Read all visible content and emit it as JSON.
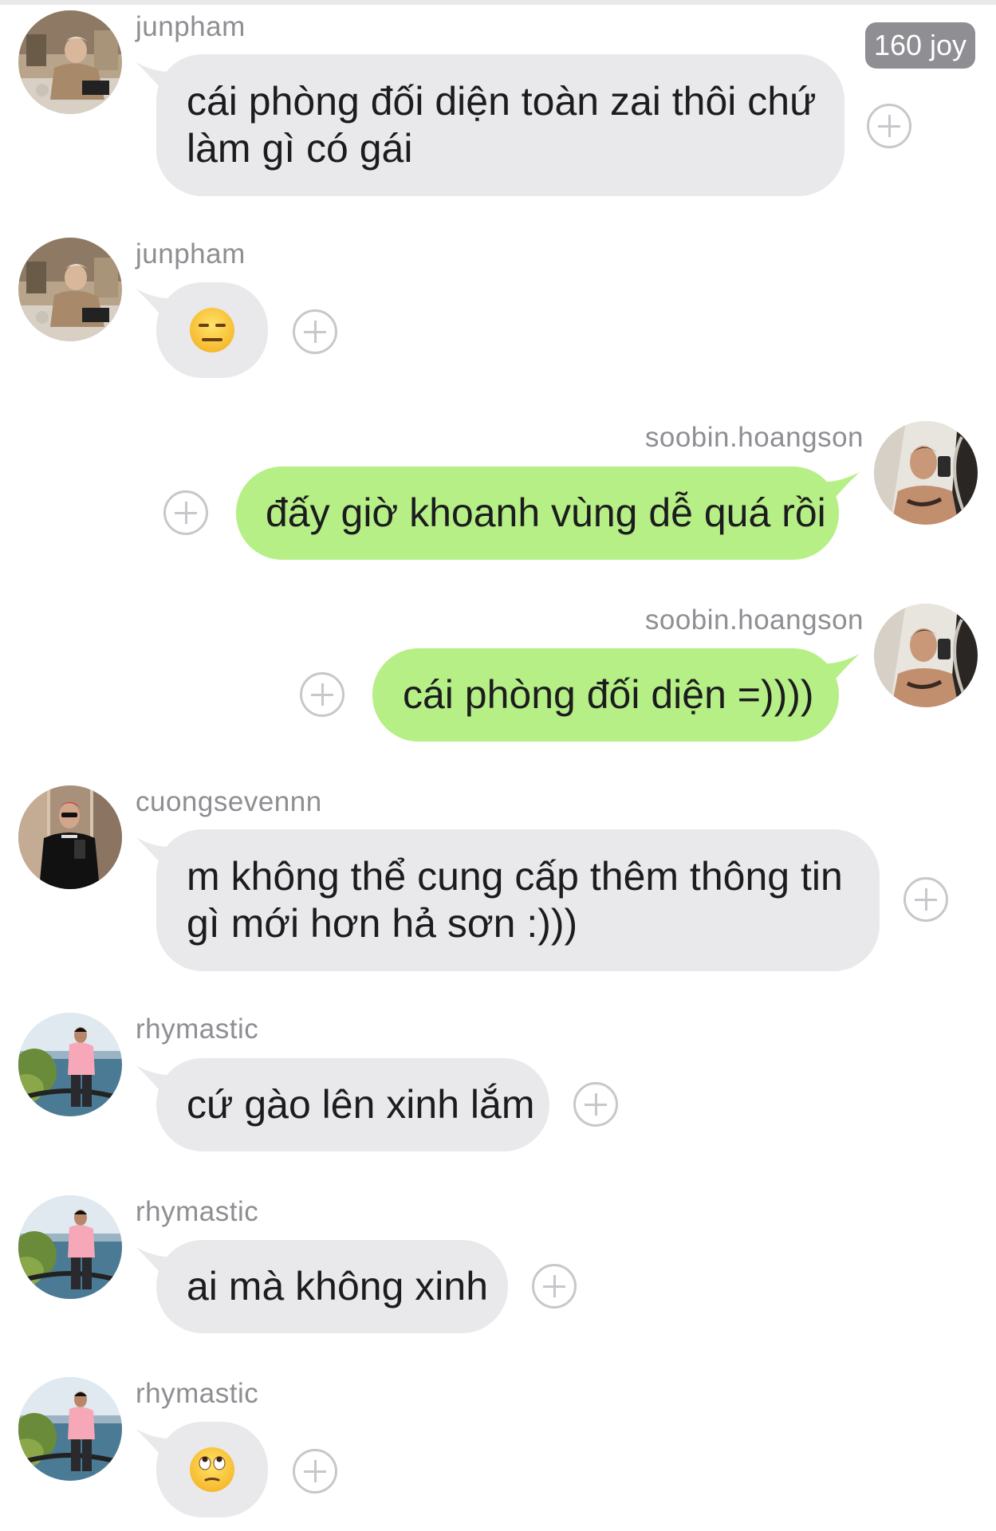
{
  "badge": {
    "label": "160 joy"
  },
  "messages": [
    {
      "sender": "junpham",
      "text_lines": [
        "cái phòng đối diện toàn zai thôi chứ",
        "làm gì có gái"
      ],
      "type": "text"
    },
    {
      "sender": "junpham",
      "type": "emoji",
      "emoji": "expressionless-face"
    },
    {
      "sender": "soobin.hoangson",
      "text_lines": [
        "đấy giờ khoanh vùng dễ quá rồi"
      ],
      "type": "text"
    },
    {
      "sender": "soobin.hoangson",
      "text_lines": [
        "cái phòng đối diện =))))"
      ],
      "type": "text"
    },
    {
      "sender": "cuongsevennn",
      "text_lines": [
        "m không thể cung cấp thêm thông tin",
        "gì mới hơn hả sơn :)))"
      ],
      "type": "text"
    },
    {
      "sender": "rhymastic",
      "text_lines": [
        "cứ gào lên xinh lắm"
      ],
      "type": "text"
    },
    {
      "sender": "rhymastic",
      "text_lines": [
        "ai mà không xinh"
      ],
      "type": "text"
    },
    {
      "sender": "rhymastic",
      "type": "emoji",
      "emoji": "face-with-rolling-eyes"
    }
  ],
  "colors": {
    "incoming_bubble": "#e9e9eb",
    "outgoing_bubble": "#b6ef86",
    "username": "#8e8e93",
    "badge": "#8e8e93"
  }
}
